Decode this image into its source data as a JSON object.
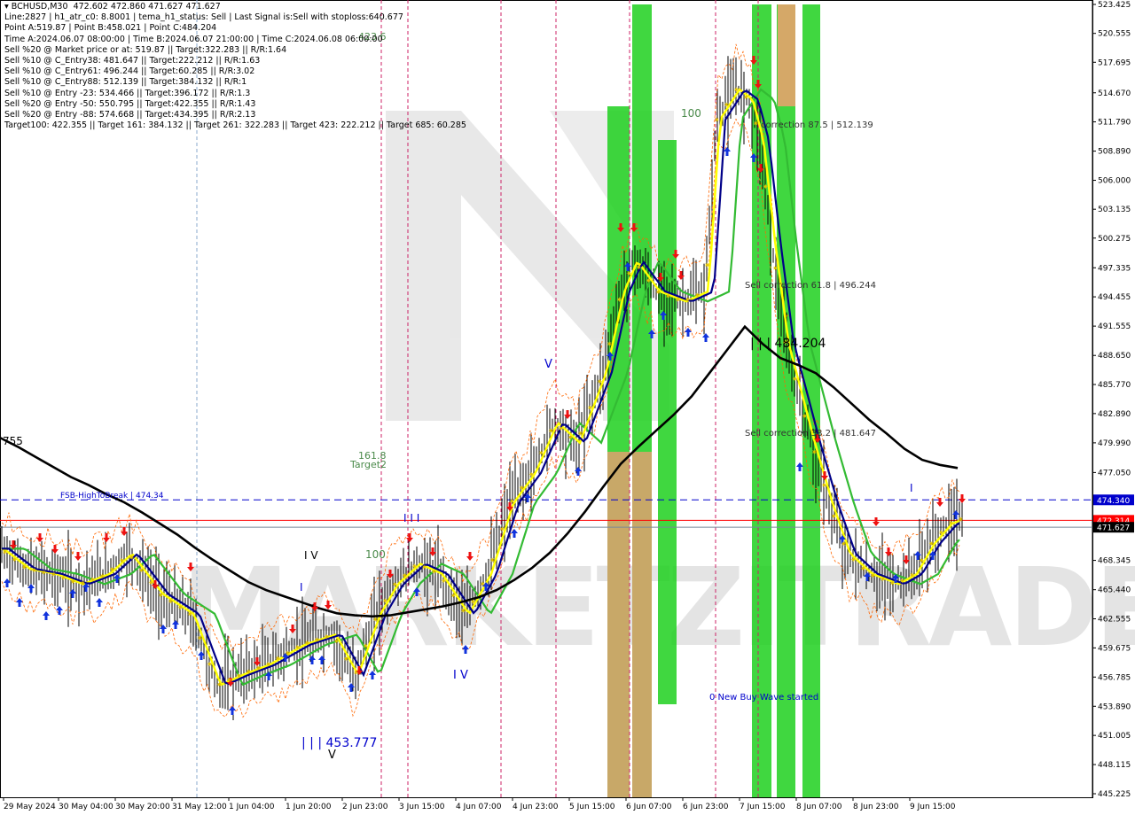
{
  "chart_data": {
    "type": "line",
    "symbol": "BCHUSD,M30",
    "ohlc": "472.602 472.860 471.627 471.627",
    "info_lines": [
      "Line:2827 | h1_atr_c0: 8.8001 | tema_h1_status: Sell | Last Signal is:Sell with stoploss:640.677",
      "Point A:519.87 | Point B:458.021 | Point C:484.204",
      "Time A:2024.06.07 08:00:00 | Time B:2024.06.07 21:00:00 | Time C:2024.06.08 06:00:00",
      "Sell %20 @ Market price or at: 519.87 || Target:322.283 || R/R:1.64",
      "Sell %10 @ C_Entry38: 481.647 || Target:222.212 || R/R:1.63",
      "Sell %10 @ C_Entry61: 496.244 || Target:60.285 || R/R:3.02",
      "Sell %10 @ C_Entry88: 512.139 || Target:384.132 || R/R:1",
      "Sell %10 @ Entry -23: 534.466 || Target:396.172 || R/R:1.3",
      "Sell %20 @ Entry -50: 550.795 || Target:422.355 || R/R:1.43",
      "Sell %20 @ Entry -88: 574.668 || Target:434.395 || R/R:2.13",
      "Target100: 422.355 || Target 161: 384.132 || Target 261: 322.283 || Target 423: 222.212 || Target 685: 60.285"
    ],
    "y_ticks": [
      "523.425",
      "520.555",
      "517.695",
      "514.670",
      "511.790",
      "508.890",
      "506.000",
      "503.135",
      "500.275",
      "497.335",
      "494.455",
      "491.555",
      "488.650",
      "485.770",
      "482.890",
      "479.990",
      "477.050",
      "474.340",
      "472.314",
      "471.627",
      "468.345",
      "465.440",
      "462.555",
      "459.675",
      "456.785",
      "453.890",
      "451.005",
      "448.115",
      "445.225"
    ],
    "x_ticks": [
      "29 May 2024",
      "30 May 04:00",
      "30 May 20:00",
      "31 May 12:00",
      "1 Jun 04:00",
      "1 Jun 20:00",
      "2 Jun 23:00",
      "3 Jun 15:00",
      "4 Jun 07:00",
      "4 Jun 23:00",
      "5 Jun 15:00",
      "6 Jun 07:00",
      "6 Jun 23:00",
      "7 Jun 15:00",
      "8 Jun 07:00",
      "8 Jun 23:00",
      "9 Jun 15:00"
    ],
    "price_tags": [
      {
        "label": "474.340",
        "value": 474.34,
        "color": "#0000cc"
      },
      {
        "label": "472.314",
        "value": 472.314,
        "color": "#ff0000"
      },
      {
        "label": "471.627",
        "value": 471.627,
        "color": "#000000"
      }
    ],
    "annotations": [
      {
        "text": "423.6",
        "color": "#4a8a4a"
      },
      {
        "text": "100",
        "color": "#4a8a4a"
      },
      {
        "text": "161.8",
        "color": "#4a8a4a"
      },
      {
        "text": "Target2",
        "color": "#4a8a4a"
      },
      {
        "text": "100",
        "color": "#4a8a4a"
      },
      {
        "text": "correction 87.5 | 512.139",
        "color": "#333333"
      },
      {
        "text": "Sell correction 61.8 | 496.244",
        "color": "#333333"
      },
      {
        "text": "Sell correction 38.2 | 481.647",
        "color": "#333333"
      },
      {
        "text": "| | | 484.204",
        "color": "#000000"
      },
      {
        "text": "| | | 453.777",
        "color": "#0000cc"
      },
      {
        "text": "FSB-HighToBreak | 474.34",
        "color": "#0000cc"
      },
      {
        "text": "0 New Buy Wave started",
        "color": "#0000cc"
      },
      {
        "text": "I V",
        "color": "#000000"
      },
      {
        "text": "I V",
        "color": "#0000cc"
      },
      {
        "text": "V",
        "color": "#0000cc"
      },
      {
        "text": "V",
        "color": "#000000"
      },
      {
        "text": "I I I",
        "color": "#0000cc"
      },
      {
        "text": "I",
        "color": "#0000cc"
      },
      {
        "text": "I",
        "color": "#0000cc"
      },
      {
        "text": "755",
        "color": "#000000"
      }
    ],
    "watermark": "MARKETZITRADE",
    "series": [
      {
        "color": "#000000",
        "x": [
          0,
          20,
          40,
          60,
          80,
          100,
          120,
          140,
          160,
          180,
          200,
          220,
          240,
          260,
          280,
          300,
          320,
          340,
          360,
          380,
          400,
          420,
          440,
          460,
          480,
          500,
          520,
          540,
          560,
          580,
          600,
          620,
          640,
          660,
          680,
          700,
          720,
          740,
          760,
          780,
          800,
          820,
          840,
          860,
          880,
          900,
          920,
          940,
          960,
          980,
          1000,
          1020,
          1040,
          1060,
          1080
        ],
        "values": [
          480.5,
          479.6,
          478.6,
          477.6,
          476.6,
          475.8,
          474.9,
          474.1,
          473.1,
          472.0,
          470.9,
          469.6,
          468.4,
          467.3,
          466.2,
          465.4,
          464.8,
          464.2,
          463.6,
          463.1,
          462.9,
          462.8,
          462.9,
          463.2,
          463.5,
          463.8,
          464.2,
          464.7,
          465.4,
          466.4,
          467.6,
          469.1,
          471.0,
          473.2,
          475.6,
          477.9,
          479.6,
          481.2,
          482.8,
          484.6,
          486.9,
          489.2,
          491.5,
          489.8,
          488.4,
          487.7,
          486.9,
          485.5,
          483.9,
          482.3,
          480.9,
          479.4,
          478.3,
          477.8,
          477.5
        ]
      }
    ]
  }
}
